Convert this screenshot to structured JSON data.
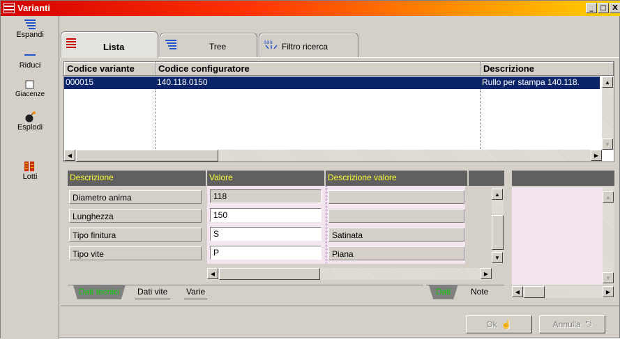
{
  "window": {
    "title": "Varianti",
    "minimize": "_",
    "maximize": "□",
    "close": "X"
  },
  "toolbar": {
    "items": [
      {
        "label": "Espandi",
        "icon": "expand-list-icon"
      },
      {
        "label": "Riduci",
        "icon": "collapse-line-icon"
      },
      {
        "label": "Giacenze",
        "icon": "checkbox-icon"
      },
      {
        "label": "Esplodi",
        "icon": "bomb-icon"
      },
      {
        "label": "Lotti",
        "icon": "lots-icon"
      }
    ]
  },
  "tabs": [
    {
      "label": "Lista",
      "icon": "list-icon",
      "active": true
    },
    {
      "label": "Tree",
      "icon": "tree-icon",
      "active": false
    },
    {
      "label": "Filtro ricerca",
      "icon": "filter-icon",
      "active": false
    }
  ],
  "grid": {
    "columns": [
      "Codice variante",
      "Codice configuratore",
      "Descrizione"
    ],
    "rows": [
      {
        "codice_variante": "000015",
        "codice_configuratore": "140.118.0150",
        "descrizione": "Rullo per stampa 140.118."
      }
    ]
  },
  "properties": {
    "columns": [
      "Descrizione",
      "Valore",
      "Descrizione valore"
    ],
    "rows": [
      {
        "descrizione": "Diametro anima",
        "valore": "118",
        "descrizione_valore": ""
      },
      {
        "descrizione": "Lunghezza",
        "valore": "150",
        "descrizione_valore": ""
      },
      {
        "descrizione": "Tipo finitura",
        "valore": "S",
        "descrizione_valore": "Satinata"
      },
      {
        "descrizione": "Tipo vite",
        "valore": "P",
        "descrizione_valore": "Piana"
      }
    ],
    "section_tabs": [
      "Dati tecnici",
      "Dati vite",
      "Varie"
    ],
    "detail_tabs": [
      "Dati",
      "Note"
    ]
  },
  "footer": {
    "ok_label": "Ok",
    "cancel_label": "Annulla"
  },
  "colors": {
    "selection": "#0a246a",
    "header_text": "#ffff33",
    "active_tab_text": "#00cc00",
    "pink_bg": "#f4e4f0"
  }
}
